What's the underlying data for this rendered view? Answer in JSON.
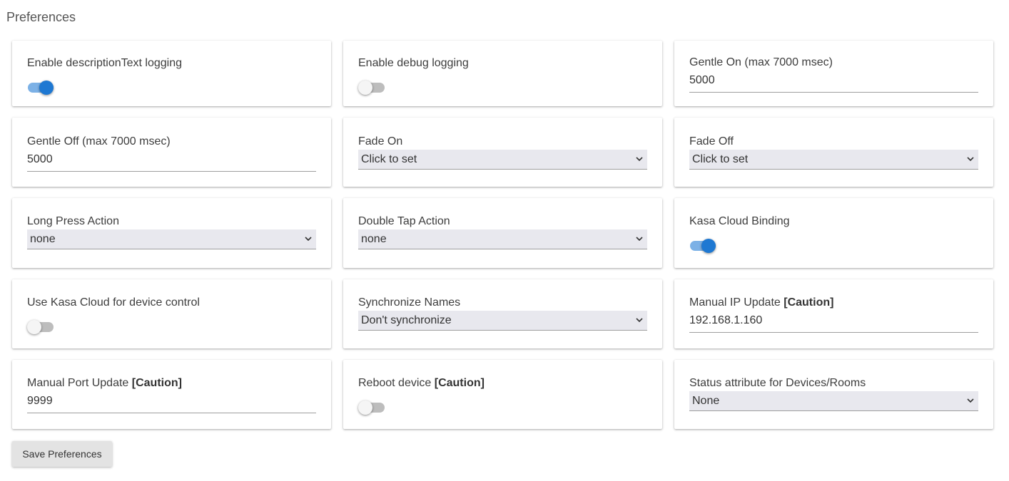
{
  "page": {
    "title": "Preferences"
  },
  "prefs": {
    "desc_logging": {
      "label": "Enable descriptionText logging",
      "value": "on"
    },
    "debug_logging": {
      "label": "Enable debug logging",
      "value": "off"
    },
    "gentle_on": {
      "label": "Gentle On (max 7000 msec)",
      "value": "5000"
    },
    "gentle_off": {
      "label": "Gentle Off (max 7000 msec)",
      "value": "5000"
    },
    "fade_on": {
      "label": "Fade On",
      "value": "Click to set"
    },
    "fade_off": {
      "label": "Fade Off",
      "value": "Click to set"
    },
    "long_press": {
      "label": "Long Press Action",
      "value": "none"
    },
    "double_tap": {
      "label": "Double Tap Action",
      "value": "none"
    },
    "kasa_binding": {
      "label": "Kasa Cloud Binding",
      "value": "on"
    },
    "kasa_control": {
      "label": "Use Kasa Cloud for device control",
      "value": "off"
    },
    "sync_names": {
      "label": "Synchronize Names",
      "value": "Don't synchronize"
    },
    "manual_ip": {
      "label": "Manual IP Update",
      "caution": "[Caution]",
      "value": "192.168.1.160"
    },
    "manual_port": {
      "label": "Manual Port Update",
      "caution": "[Caution]",
      "value": "9999"
    },
    "reboot": {
      "label": "Reboot device",
      "caution": "[Caution]",
      "value": "off"
    },
    "status_attr": {
      "label": "Status attribute for Devices/Rooms",
      "value": "None"
    }
  },
  "actions": {
    "save_label": "Save Preferences"
  },
  "colors": {
    "accent": "#1e78d2",
    "track_on": "#7cb1e6",
    "track_off": "#bdbdbd",
    "select_bg": "#e8e8ee"
  },
  "icons": {
    "select_arrow": "chevron-down-icon"
  }
}
